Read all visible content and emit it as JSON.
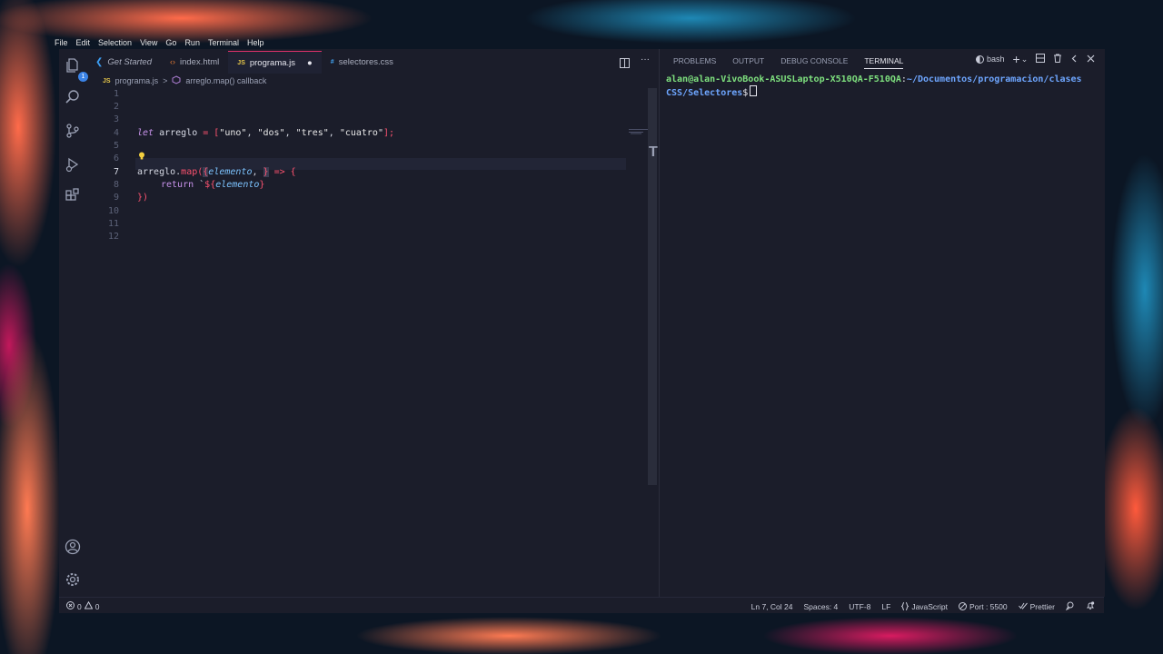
{
  "menu": [
    "File",
    "Edit",
    "Selection",
    "View",
    "Go",
    "Run",
    "Terminal",
    "Help"
  ],
  "tabs": [
    {
      "label": "Get Started",
      "icon": "vscode-icon"
    },
    {
      "label": "index.html",
      "icon": "html-icon"
    },
    {
      "label": "programa.js",
      "icon": "js-icon",
      "modified_marker": "●"
    },
    {
      "label": "selectores.css",
      "icon": "css-icon"
    }
  ],
  "file_icon_text": {
    "js": "JS",
    "css": "#"
  },
  "breadcrumb": {
    "file": "programa.js",
    "symbol": "arreglo.map() callback",
    "sep": ">"
  },
  "editor": {
    "line_numbers": [
      "1",
      "2",
      "3",
      "4",
      "5",
      "6",
      "7",
      "8",
      "9",
      "10",
      "11",
      "12"
    ],
    "line4": {
      "kw": "let",
      "name": " arreglo ",
      "eq": "=",
      "open": " [",
      "s1": "\"uno\"",
      "c1": ", ",
      "s2": "\"dos\"",
      "c2": ", ",
      "s3": "\"tres\"",
      "c3": ", ",
      "s4": "\"cuatro\"",
      "close": "];"
    },
    "line7": {
      "obj": "arreglo.",
      "fn": "map",
      "paren": "(",
      "brace": "{",
      "param": "elemento",
      "comma": ", ",
      "cursor_char": "}",
      "arrow": " =>",
      "open": " {"
    },
    "line8": {
      "kw": "return",
      "tick": " `",
      "interp": "${",
      "param": "elemento",
      "close": "}"
    },
    "line9": "})"
  },
  "panel": {
    "tabs": [
      "PROBLEMS",
      "OUTPUT",
      "DEBUG CONSOLE",
      "TERMINAL"
    ],
    "active_tab": "TERMINAL",
    "shell": "bash",
    "add": "+",
    "dropdown": "⌄"
  },
  "terminal": {
    "user_host": "alan@alan-VivoBook-ASUSLaptop-X510QA-F510QA",
    "colon": ":",
    "path_line1": "~/Documentos/programacion/clases",
    "path_line2": "CSS/Selectores",
    "prompt": "$"
  },
  "status": {
    "errors": "0",
    "warnings": "0",
    "position": "Ln 7, Col 24",
    "spaces": "Spaces: 4",
    "encoding": "UTF-8",
    "eol": "LF",
    "language": "JavaScript",
    "port": "Port : 5500",
    "prettier": "Prettier"
  },
  "activity_badge": "1",
  "colors": {
    "accent": "#e0316b",
    "bg": "#1b1d2a",
    "terminal_user": "#7ee07e",
    "terminal_path": "#6ea6ff"
  }
}
